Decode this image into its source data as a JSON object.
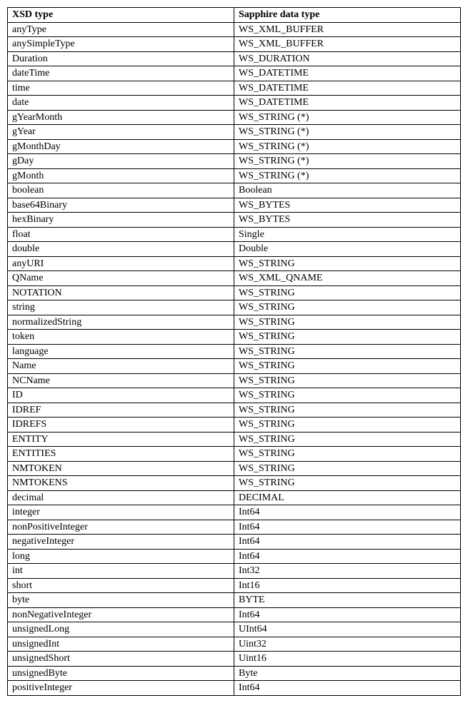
{
  "table": {
    "headers": [
      "XSD type",
      "Sapphire data type"
    ],
    "rows": [
      [
        "anyType",
        "WS_XML_BUFFER"
      ],
      [
        "anySimpleType",
        "WS_XML_BUFFER"
      ],
      [
        "Duration",
        "WS_DURATION"
      ],
      [
        "dateTime",
        "WS_DATETIME"
      ],
      [
        "time",
        "WS_DATETIME"
      ],
      [
        "date",
        "WS_DATETIME"
      ],
      [
        "gYearMonth",
        "WS_STRING (*)"
      ],
      [
        "gYear",
        "WS_STRING (*)"
      ],
      [
        "gMonthDay",
        "WS_STRING (*)"
      ],
      [
        "gDay",
        "WS_STRING (*)"
      ],
      [
        "gMonth",
        "WS_STRING (*)"
      ],
      [
        "boolean",
        "Boolean"
      ],
      [
        "base64Binary",
        "WS_BYTES"
      ],
      [
        "hexBinary",
        " WS_BYTES"
      ],
      [
        "float",
        "Single"
      ],
      [
        "double",
        "Double"
      ],
      [
        "anyURI",
        "WS_STRING"
      ],
      [
        "QName",
        "WS_XML_QNAME"
      ],
      [
        "NOTATION",
        "WS_STRING"
      ],
      [
        "string",
        "WS_STRING"
      ],
      [
        "normalizedString",
        "WS_STRING"
      ],
      [
        "token",
        "WS_STRING"
      ],
      [
        "language",
        "WS_STRING"
      ],
      [
        "Name",
        "WS_STRING"
      ],
      [
        "NCName",
        "WS_STRING"
      ],
      [
        "ID",
        "WS_STRING"
      ],
      [
        "IDREF",
        "WS_STRING"
      ],
      [
        "IDREFS",
        "WS_STRING"
      ],
      [
        "ENTITY",
        "WS_STRING"
      ],
      [
        "ENTITIES",
        "WS_STRING"
      ],
      [
        "NMTOKEN",
        "WS_STRING"
      ],
      [
        "NMTOKENS",
        "WS_STRING"
      ],
      [
        "decimal",
        "DECIMAL"
      ],
      [
        "integer",
        "Int64"
      ],
      [
        "nonPositiveInteger",
        "Int64"
      ],
      [
        "negativeInteger",
        "Int64"
      ],
      [
        "long",
        "Int64"
      ],
      [
        "int",
        "Int32"
      ],
      [
        "short",
        "Int16"
      ],
      [
        "byte",
        "BYTE"
      ],
      [
        "nonNegativeInteger",
        "Int64"
      ],
      [
        "unsignedLong",
        "UInt64"
      ],
      [
        "unsignedInt",
        "Uint32"
      ],
      [
        "unsignedShort",
        "Uint16"
      ],
      [
        "unsignedByte",
        "Byte"
      ],
      [
        "positiveInteger",
        "Int64"
      ]
    ]
  }
}
